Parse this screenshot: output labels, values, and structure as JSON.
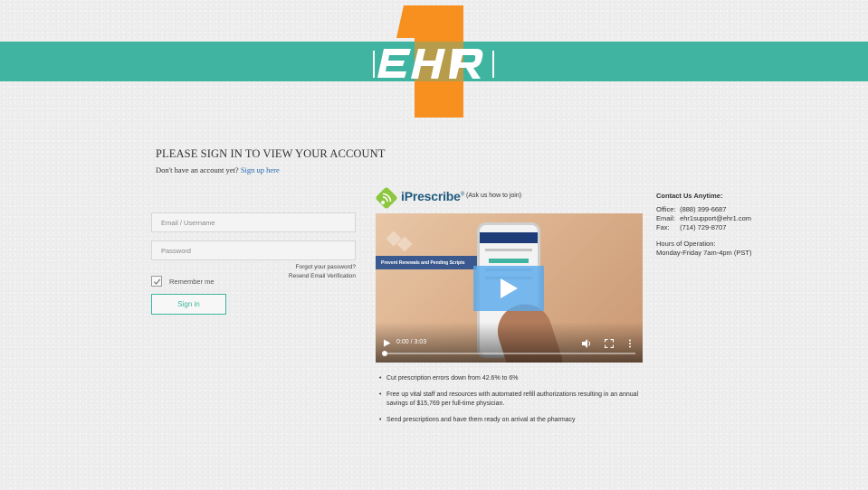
{
  "header": {
    "logo_text": "EHR1",
    "brand_color": "#40b4a0",
    "accent_color": "#f7901e"
  },
  "signin": {
    "title": "PLEASE SIGN IN TO VIEW YOUR ACCOUNT",
    "no_account": "Don't have an account yet?",
    "signup_link": "Sign up here",
    "email_placeholder": "Email / Username",
    "password_placeholder": "Password",
    "remember_label": "Remember me",
    "remember_checked": true,
    "forgot_link": "Forgot your password?",
    "resend_link": "Resend Email Verification",
    "signin_button": "Sign in"
  },
  "iprescribe": {
    "brand": "iPrescribe",
    "trademark": "®",
    "ask": "(Ask us how to join)",
    "video": {
      "overlay_text": "Prevent Renewals and Pending Scripts",
      "time": "0:00 / 3:03",
      "progress": 0
    },
    "bullets": [
      "Cut prescription errors down from 42.6% to 6%",
      "Free up vital staff and resources with automated refill authorizations resulting in an annual savings of $15,769 per full-time physician.",
      "Send prescriptions and have them ready on arrival at the pharmacy"
    ]
  },
  "contact": {
    "heading": "Contact Us Anytime:",
    "office_label": "Office:",
    "office": "(888) 399-6687",
    "email_label": "Email:",
    "email": "ehr1support@ehr1.com",
    "fax_label": "Fax:",
    "fax": "(714) 729-8707",
    "hours_heading": "Hours of Operation:",
    "hours": "Monday-Friday 7am-4pm (PST)"
  }
}
